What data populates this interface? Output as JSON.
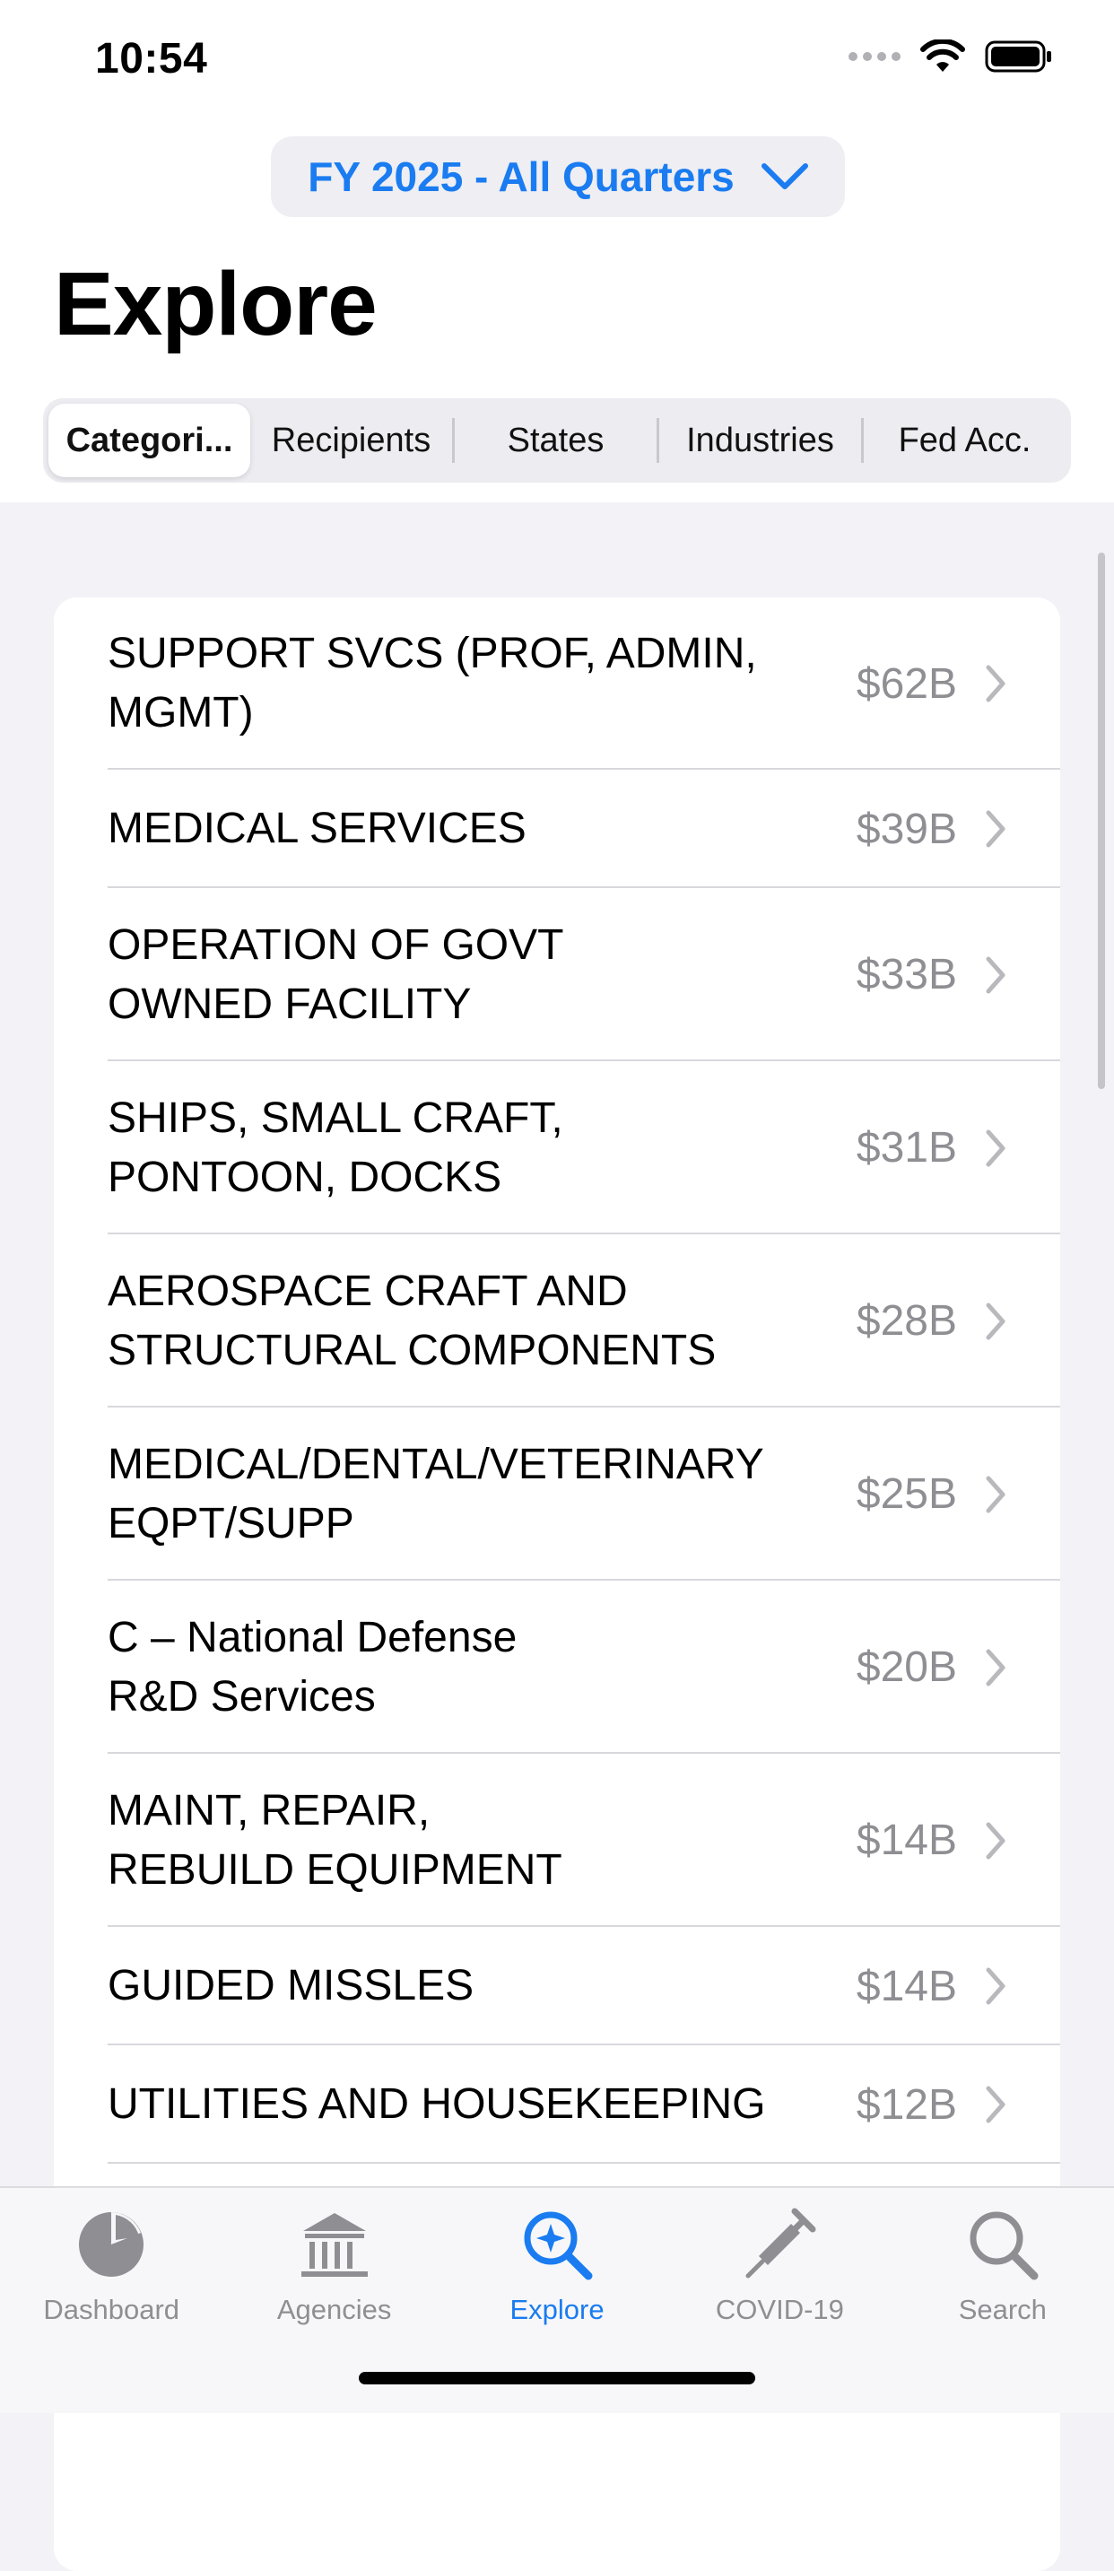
{
  "status": {
    "time": "10:54"
  },
  "header": {
    "period_selector": "FY 2025 - All Quarters",
    "title": "Explore"
  },
  "segments": [
    {
      "label": "Categori...",
      "active": true
    },
    {
      "label": "Recipients",
      "active": false
    },
    {
      "label": "States",
      "active": false
    },
    {
      "label": "Industries",
      "active": false
    },
    {
      "label": "Fed Acc.",
      "active": false
    }
  ],
  "list": [
    {
      "label": "SUPPORT SVCS (PROF, ADMIN, MGMT)",
      "value": "$62B"
    },
    {
      "label": "MEDICAL SERVICES",
      "value": "$39B"
    },
    {
      "label": "OPERATION OF GOVT OWNED FACILITY",
      "value": "$33B"
    },
    {
      "label": "SHIPS, SMALL CRAFT, PONTOON, DOCKS",
      "value": "$31B"
    },
    {
      "label": "AEROSPACE CRAFT AND STRUCTURAL COMPONENTS",
      "value": "$28B"
    },
    {
      "label": "MEDICAL/DENTAL/VETERINARY EQPT/SUPP",
      "value": "$25B"
    },
    {
      "label": "C – National Defense R&D Services",
      "value": "$20B"
    },
    {
      "label": "MAINT, REPAIR, REBUILD EQUIPMENT",
      "value": "$14B"
    },
    {
      "label": "GUIDED MISSLES",
      "value": "$14B"
    },
    {
      "label": "UTILITIES AND HOUSEKEEPING",
      "value": "$12B"
    },
    {
      "label": "",
      "value": ""
    }
  ],
  "tabbar": [
    {
      "label": "Dashboard",
      "icon": "pie-chart-icon",
      "active": false
    },
    {
      "label": "Agencies",
      "icon": "building-columns-icon",
      "active": false
    },
    {
      "label": "Explore",
      "icon": "magnify-sparkle-icon",
      "active": true
    },
    {
      "label": "COVID-19",
      "icon": "syringe-icon",
      "active": false
    },
    {
      "label": "Search",
      "icon": "search-icon",
      "active": false
    }
  ],
  "colors": {
    "accent": "#1a7cf0",
    "secondary_text": "#8e8e93",
    "background": "#f2f2f7"
  }
}
